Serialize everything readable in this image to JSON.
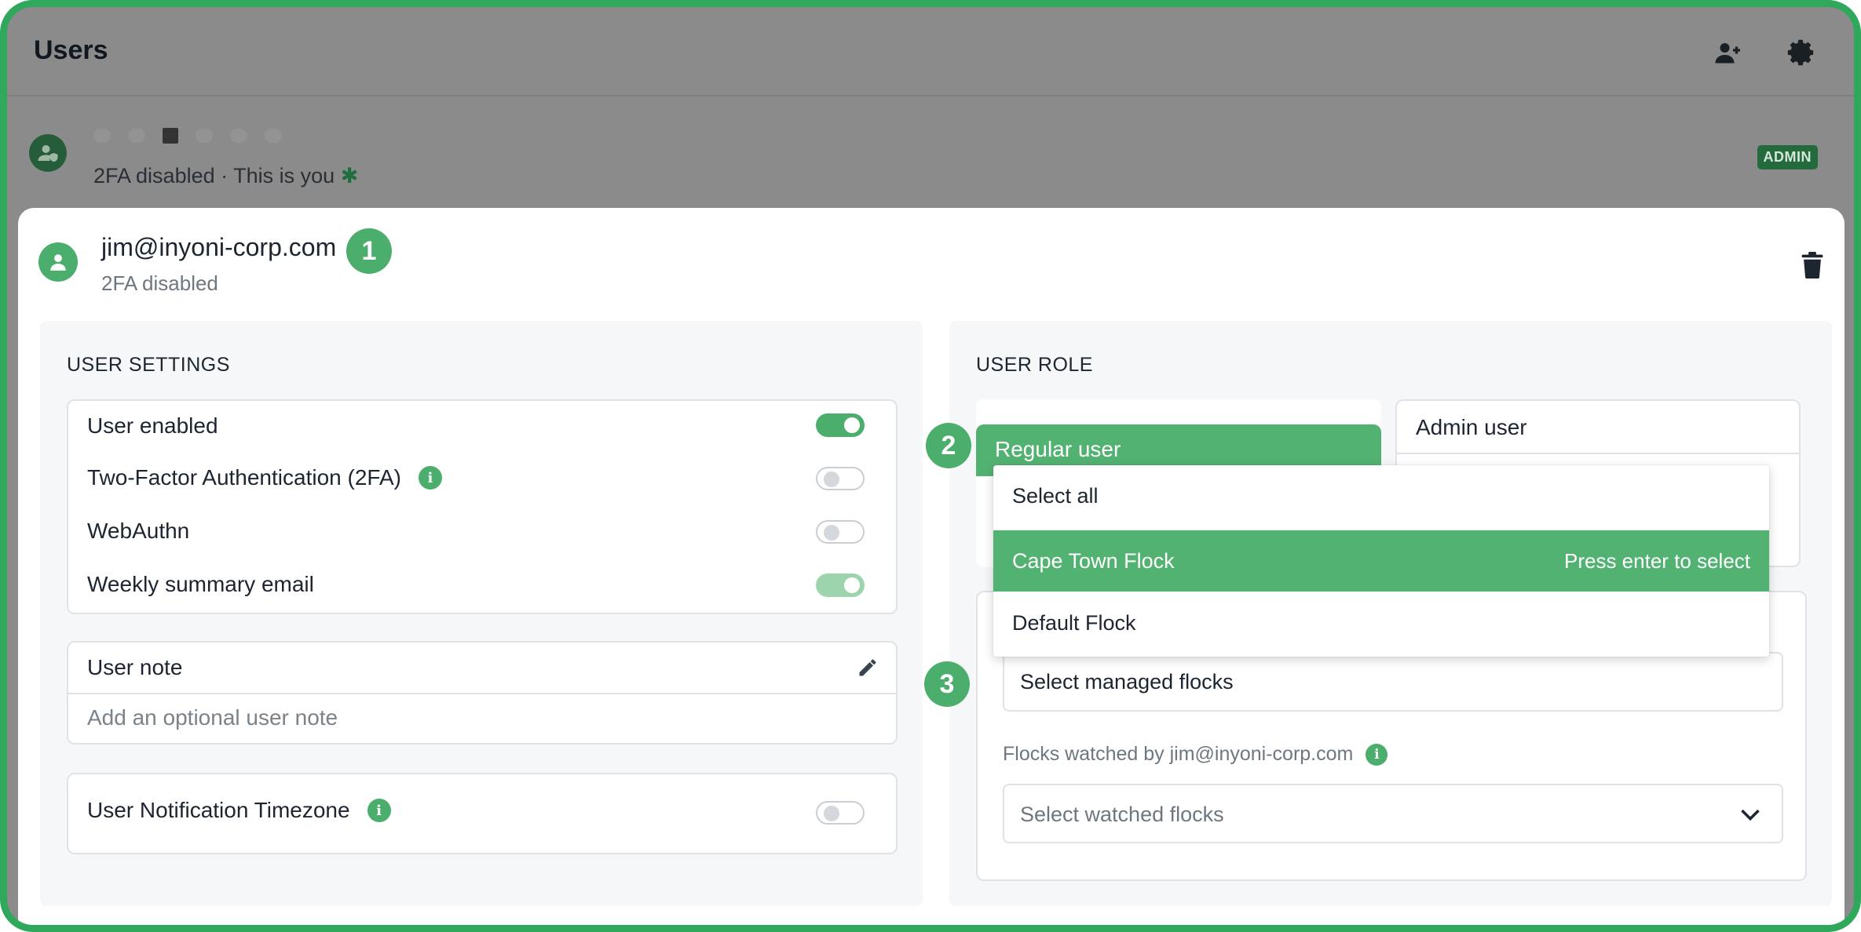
{
  "header": {
    "title": "Users"
  },
  "current_user": {
    "status": "2FA disabled · This is you",
    "badge": "ADMIN"
  },
  "selected_user": {
    "email": "jim@inyoni-corp.com",
    "status": "2FA disabled"
  },
  "steps": [
    "1",
    "2",
    "3"
  ],
  "user_settings": {
    "heading": "USER SETTINGS",
    "rows": [
      {
        "label": "User enabled",
        "state": "on"
      },
      {
        "label": "Two-Factor Authentication (2FA)",
        "state": "off",
        "info": true
      },
      {
        "label": "WebAuthn",
        "state": "off"
      },
      {
        "label": "Weekly summary email",
        "state": "on"
      }
    ],
    "note": {
      "label": "User note",
      "placeholder": "Add an optional user note"
    },
    "timezone": {
      "label": "User Notification Timezone",
      "state": "off"
    }
  },
  "user_role": {
    "heading": "USER ROLE",
    "regular_label": "Regular user",
    "admin_label": "Admin user",
    "managed_placeholder": "Select managed flocks",
    "watched_label": "Flocks watched by jim@inyoni-corp.com",
    "watched_placeholder": "Select watched flocks"
  },
  "dropdown": {
    "items": [
      "Select all",
      "Cape Town Flock",
      "Default Flock"
    ],
    "active_index": 1,
    "hint": "Press enter to select"
  },
  "colors": {
    "accent": "#4cae6c",
    "frame": "#2fa85c"
  }
}
